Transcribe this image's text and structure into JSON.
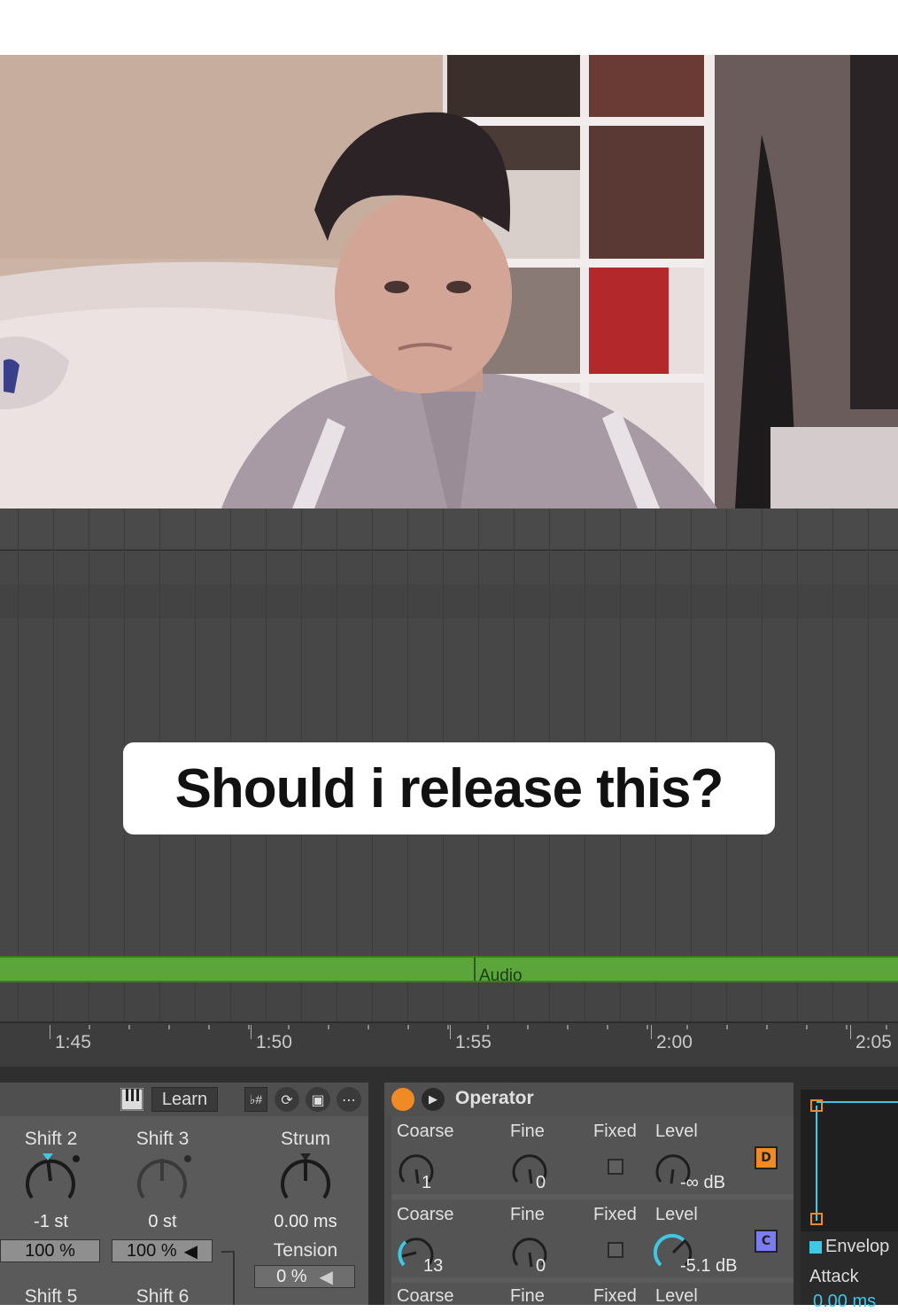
{
  "caption": {
    "text": "Should i release this?"
  },
  "arrangement": {
    "clip_label": "Audio",
    "ruler_ticks": [
      "1:45",
      "1:50",
      "1:55",
      "2:00",
      "2:05"
    ]
  },
  "chord_device": {
    "learn_label": "Learn",
    "shift2": {
      "label": "Shift 2",
      "value": "-1 st",
      "velocity": "100 %"
    },
    "shift3": {
      "label": "Shift 3",
      "value": "0 st",
      "velocity": "100 %"
    },
    "strum": {
      "label": "Strum",
      "value": "0.00 ms"
    },
    "tension": {
      "label": "Tension",
      "value": "0 %"
    },
    "shift5": {
      "label": "Shift 5"
    },
    "shift6": {
      "label": "Shift 6"
    }
  },
  "operator": {
    "title": "Operator",
    "rows": [
      {
        "coarse_label": "Coarse",
        "fine_label": "Fine",
        "fixed_label": "Fixed",
        "level_label": "Level",
        "coarse_value": "1",
        "fine_value": "0",
        "level_value": "-∞ dB",
        "osc": "D",
        "osc_color": "#f08a24"
      },
      {
        "coarse_label": "Coarse",
        "fine_label": "Fine",
        "fixed_label": "Fixed",
        "level_label": "Level",
        "coarse_value": "13",
        "fine_value": "0",
        "level_value": "-5.1 dB",
        "osc": "C",
        "osc_color": "#7a7cf0"
      },
      {
        "coarse_label": "Coarse",
        "fine_label": "Fine",
        "fixed_label": "Fixed",
        "level_label": "Level"
      }
    ]
  },
  "envelope": {
    "title": "Envelop",
    "attack_label": "Attack",
    "attack_value": "0.00 ms"
  },
  "colors": {
    "clip_green": "#5ca53a",
    "accent_cyan": "#3fc7e6",
    "device_on": "#f08a24"
  }
}
